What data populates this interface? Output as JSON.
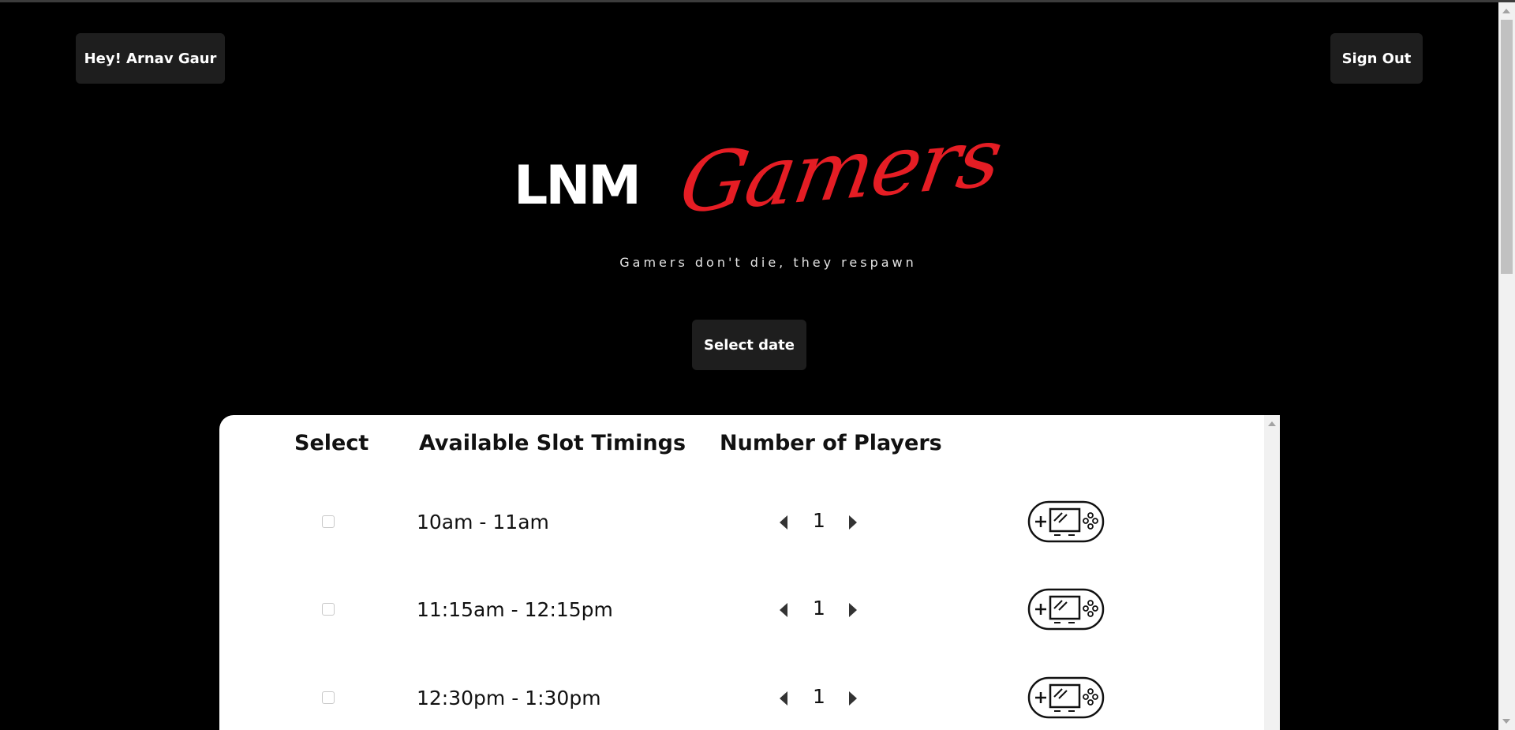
{
  "header": {
    "greeting_label": "Hey! Arnav Gaur",
    "signout_label": "Sign Out"
  },
  "logo": {
    "part1": "LNM",
    "part2": "Gamers",
    "tagline": "Gamers don't die, they respawn"
  },
  "date_button_label": "Select date",
  "table": {
    "headers": {
      "select": "Select",
      "timings": "Available Slot Timings",
      "players": "Number of Players"
    },
    "rows": [
      {
        "time": "10am - 11am",
        "players": "1"
      },
      {
        "time": "11:15am - 12:15pm",
        "players": "1"
      },
      {
        "time": "12:30pm - 1:30pm",
        "players": "1"
      }
    ]
  },
  "colors": {
    "background": "#000000",
    "accent": "#e51d24",
    "button_bg": "#1e1e1e",
    "panel_bg": "#ffffff"
  },
  "icons": {
    "row_action": "add-game-console-icon"
  }
}
